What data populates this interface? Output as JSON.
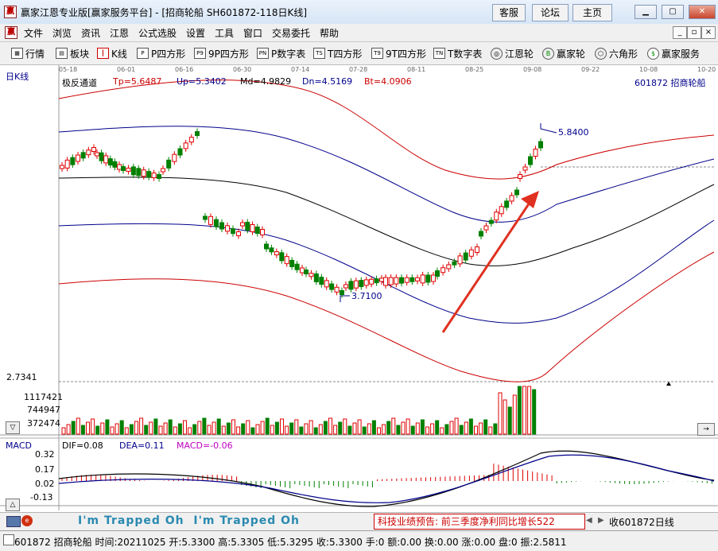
{
  "window": {
    "title": "赢家江恩专业版[赢家服务平台] - [招商轮船  SH601872-118日K线]",
    "buttons": [
      "客服",
      "论坛",
      "主页"
    ]
  },
  "menu": [
    "文件",
    "浏览",
    "资讯",
    "江恩",
    "公式选股",
    "设置",
    "工具",
    "窗口",
    "交易委托",
    "帮助"
  ],
  "toolbar": [
    {
      "label": "行情",
      "icon": "grid-icon"
    },
    {
      "label": "板块",
      "icon": "blocks-icon"
    },
    {
      "label": "K线",
      "icon": "candles-icon"
    },
    {
      "label": "P四方形",
      "icon": "P"
    },
    {
      "label": "9P四方形",
      "icon": "P9"
    },
    {
      "label": "P数字表",
      "icon": "PN"
    },
    {
      "label": "T四方形",
      "icon": "TS"
    },
    {
      "label": "9T四方形",
      "icon": "T9"
    },
    {
      "label": "T数字表",
      "icon": "TN"
    },
    {
      "label": "江恩轮",
      "icon": "wheel-icon"
    },
    {
      "label": "赢家轮",
      "icon": "big-icon"
    },
    {
      "label": "六角形",
      "icon": "hexagon-icon"
    },
    {
      "label": "赢家服务",
      "icon": "dollar-icon"
    }
  ],
  "chart": {
    "period_label": "日K线",
    "stock_label": "601872  招商轮船",
    "dates": [
      "05-18",
      "06-01",
      "06-16",
      "06-30",
      "07-14",
      "07-28",
      "08-11",
      "08-25",
      "09-08",
      "09-22",
      "10-08",
      "10-20"
    ],
    "indicator_header": {
      "name": "极反通道",
      "tp": "Tp=5.6487",
      "up": "Up=5.3402",
      "md": "Md=4.9829",
      "dn": "Dn=4.5169",
      "bt": "Bt=4.0906"
    },
    "high_label": "5.8400",
    "low_label": "3.7100",
    "main_axis_value": "2.7341",
    "volume_axis": [
      "1117421",
      "744947",
      "372474"
    ],
    "macd_label": "MACD",
    "macd_header": {
      "dif": "DIF=0.08",
      "dea": "DEA=0.11",
      "macd": "MACD=-0.06"
    },
    "macd_axis": [
      "0.32",
      "0.17",
      "0.02",
      "-0.13"
    ],
    "colors": {
      "up": "#e00000",
      "down": "#008000",
      "channel_outer": "#d00000",
      "channel_inner": "#00008b",
      "channel_mid": "#000000",
      "arrow": "#e03020",
      "macd_text": "#c000c0"
    }
  },
  "bottom": {
    "watermark_text": "I'm Trapped Oh  I'm Trapped Oh",
    "news": "科技业绩预告: 前三季度净利同比增长522",
    "close_label": "收601872日线"
  },
  "status": "601872 招商轮船 时间:20211025 开:5.3300 高:5.3305 低:5.3295 收:5.3300 手:0 额:0.00 换:0.00 涨:0.00 盘:0 振:2.5811"
}
